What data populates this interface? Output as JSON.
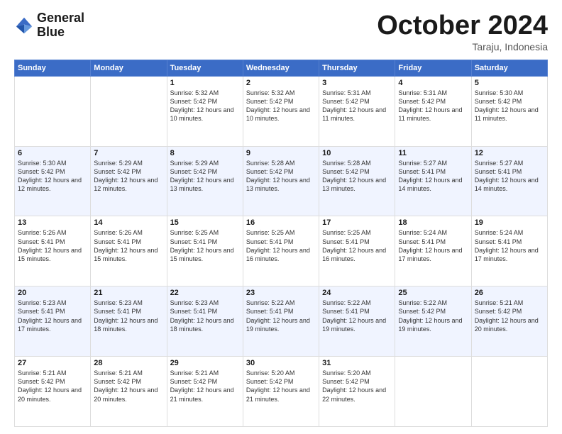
{
  "logo": {
    "line1": "General",
    "line2": "Blue"
  },
  "header": {
    "month": "October 2024",
    "location": "Taraju, Indonesia"
  },
  "days_of_week": [
    "Sunday",
    "Monday",
    "Tuesday",
    "Wednesday",
    "Thursday",
    "Friday",
    "Saturday"
  ],
  "weeks": [
    [
      {
        "day": "",
        "info": ""
      },
      {
        "day": "",
        "info": ""
      },
      {
        "day": "1",
        "info": "Sunrise: 5:32 AM\nSunset: 5:42 PM\nDaylight: 12 hours\nand 10 minutes."
      },
      {
        "day": "2",
        "info": "Sunrise: 5:32 AM\nSunset: 5:42 PM\nDaylight: 12 hours\nand 10 minutes."
      },
      {
        "day": "3",
        "info": "Sunrise: 5:31 AM\nSunset: 5:42 PM\nDaylight: 12 hours\nand 11 minutes."
      },
      {
        "day": "4",
        "info": "Sunrise: 5:31 AM\nSunset: 5:42 PM\nDaylight: 12 hours\nand 11 minutes."
      },
      {
        "day": "5",
        "info": "Sunrise: 5:30 AM\nSunset: 5:42 PM\nDaylight: 12 hours\nand 11 minutes."
      }
    ],
    [
      {
        "day": "6",
        "info": "Sunrise: 5:30 AM\nSunset: 5:42 PM\nDaylight: 12 hours\nand 12 minutes."
      },
      {
        "day": "7",
        "info": "Sunrise: 5:29 AM\nSunset: 5:42 PM\nDaylight: 12 hours\nand 12 minutes."
      },
      {
        "day": "8",
        "info": "Sunrise: 5:29 AM\nSunset: 5:42 PM\nDaylight: 12 hours\nand 13 minutes."
      },
      {
        "day": "9",
        "info": "Sunrise: 5:28 AM\nSunset: 5:42 PM\nDaylight: 12 hours\nand 13 minutes."
      },
      {
        "day": "10",
        "info": "Sunrise: 5:28 AM\nSunset: 5:42 PM\nDaylight: 12 hours\nand 13 minutes."
      },
      {
        "day": "11",
        "info": "Sunrise: 5:27 AM\nSunset: 5:41 PM\nDaylight: 12 hours\nand 14 minutes."
      },
      {
        "day": "12",
        "info": "Sunrise: 5:27 AM\nSunset: 5:41 PM\nDaylight: 12 hours\nand 14 minutes."
      }
    ],
    [
      {
        "day": "13",
        "info": "Sunrise: 5:26 AM\nSunset: 5:41 PM\nDaylight: 12 hours\nand 15 minutes."
      },
      {
        "day": "14",
        "info": "Sunrise: 5:26 AM\nSunset: 5:41 PM\nDaylight: 12 hours\nand 15 minutes."
      },
      {
        "day": "15",
        "info": "Sunrise: 5:25 AM\nSunset: 5:41 PM\nDaylight: 12 hours\nand 15 minutes."
      },
      {
        "day": "16",
        "info": "Sunrise: 5:25 AM\nSunset: 5:41 PM\nDaylight: 12 hours\nand 16 minutes."
      },
      {
        "day": "17",
        "info": "Sunrise: 5:25 AM\nSunset: 5:41 PM\nDaylight: 12 hours\nand 16 minutes."
      },
      {
        "day": "18",
        "info": "Sunrise: 5:24 AM\nSunset: 5:41 PM\nDaylight: 12 hours\nand 17 minutes."
      },
      {
        "day": "19",
        "info": "Sunrise: 5:24 AM\nSunset: 5:41 PM\nDaylight: 12 hours\nand 17 minutes."
      }
    ],
    [
      {
        "day": "20",
        "info": "Sunrise: 5:23 AM\nSunset: 5:41 PM\nDaylight: 12 hours\nand 17 minutes."
      },
      {
        "day": "21",
        "info": "Sunrise: 5:23 AM\nSunset: 5:41 PM\nDaylight: 12 hours\nand 18 minutes."
      },
      {
        "day": "22",
        "info": "Sunrise: 5:23 AM\nSunset: 5:41 PM\nDaylight: 12 hours\nand 18 minutes."
      },
      {
        "day": "23",
        "info": "Sunrise: 5:22 AM\nSunset: 5:41 PM\nDaylight: 12 hours\nand 19 minutes."
      },
      {
        "day": "24",
        "info": "Sunrise: 5:22 AM\nSunset: 5:41 PM\nDaylight: 12 hours\nand 19 minutes."
      },
      {
        "day": "25",
        "info": "Sunrise: 5:22 AM\nSunset: 5:42 PM\nDaylight: 12 hours\nand 19 minutes."
      },
      {
        "day": "26",
        "info": "Sunrise: 5:21 AM\nSunset: 5:42 PM\nDaylight: 12 hours\nand 20 minutes."
      }
    ],
    [
      {
        "day": "27",
        "info": "Sunrise: 5:21 AM\nSunset: 5:42 PM\nDaylight: 12 hours\nand 20 minutes."
      },
      {
        "day": "28",
        "info": "Sunrise: 5:21 AM\nSunset: 5:42 PM\nDaylight: 12 hours\nand 20 minutes."
      },
      {
        "day": "29",
        "info": "Sunrise: 5:21 AM\nSunset: 5:42 PM\nDaylight: 12 hours\nand 21 minutes."
      },
      {
        "day": "30",
        "info": "Sunrise: 5:20 AM\nSunset: 5:42 PM\nDaylight: 12 hours\nand 21 minutes."
      },
      {
        "day": "31",
        "info": "Sunrise: 5:20 AM\nSunset: 5:42 PM\nDaylight: 12 hours\nand 22 minutes."
      },
      {
        "day": "",
        "info": ""
      },
      {
        "day": "",
        "info": ""
      }
    ]
  ]
}
